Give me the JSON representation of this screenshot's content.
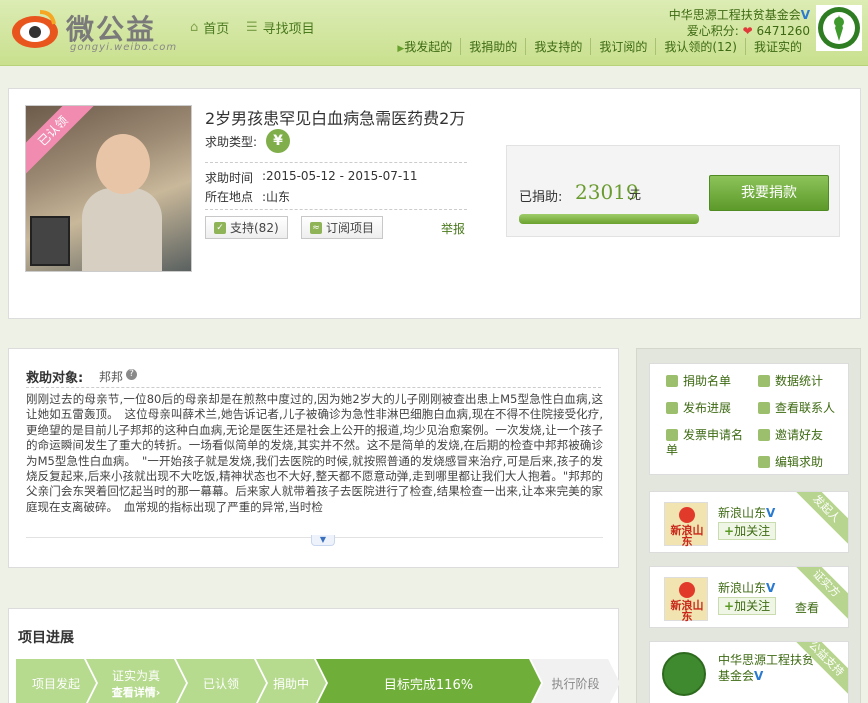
{
  "header": {
    "logo_title": "微公益",
    "logo_domain": "gongyi.weibo.com",
    "nav": [
      {
        "label": "首页",
        "icon": "home-icon"
      },
      {
        "label": "寻找项目",
        "icon": "list-icon"
      }
    ],
    "org_name": "中华思源工程扶贫基金会",
    "love_label": "爱心积分:",
    "love_value": "6471260",
    "subnav": [
      "我发起的",
      "我捐助的",
      "我支持的",
      "我订阅的",
      "我认领的(12)",
      "我证实的"
    ]
  },
  "project": {
    "ribbon": "已认领",
    "title": "2岁男孩患罕见白血病急需医药费2万",
    "help_type_label": "求助类型:",
    "help_type_icon": "¥",
    "time_label": "求助时间",
    "time_value": ":2015-05-12 - 2015-07-11",
    "place_label": "所在地点",
    "place_value": ":山东",
    "support_label": "支持(82)",
    "subscribe_label": "订阅项目",
    "report_label": "举报",
    "donated_label": "已捐助:",
    "donated_value": "23019",
    "donated_unit": "元",
    "donate_progress": 1.0,
    "donate_button": "我要捐款"
  },
  "story": {
    "heading": "救助对象:",
    "name": "邦邦",
    "help_icon": "?",
    "text": "刚刚过去的母亲节,一位80后的母亲却是在煎熬中度过的,因为她2岁大的儿子刚刚被查出患上M5型急性白血病,这让她如五雷轰顶。　这位母亲叫薛术兰,她告诉记者,儿子被确诊为急性非淋巴细胞白血病,现在不得不住院接受化疗,更绝望的是目前儿子邦邦的这种白血病,无论是医生还是社会上公开的报道,均少见治愈案例。一次发烧,让一个孩子的命运瞬间发生了重大的转折。一场看似简单的发烧,其实并不然。这不是简单的发烧,在后期的检查中邦邦被确诊为M5型急性白血病。　\"一开始孩子就是发烧,我们去医院的时候,就按照普通的发烧感冒来治疗,可是后来,孩子的发烧反复起来,后来小孩就出现不大吃饭,精神状态也不大好,整天都不愿意动弹,走到哪里都让我们大人抱着。\"邦邦的父亲门会东哭着回忆起当时的那一幕幕。后来家人就带着孩子去医院进行了检查,结果检查一出来,让本来完美的家庭现在支离破碎。　血常规的指标出现了严重的异常,当时检"
  },
  "progress": {
    "title": "项目进展",
    "steps": [
      {
        "label": "项目发起",
        "sub": ""
      },
      {
        "label": "证实为真",
        "sub": "查看详情›"
      },
      {
        "label": "已认领",
        "sub": ""
      },
      {
        "label": "捐助中",
        "sub": ""
      },
      {
        "label": "目标完成116%",
        "sub": ""
      },
      {
        "label": "执行阶段",
        "sub": ""
      }
    ]
  },
  "sidebar": {
    "actions": [
      {
        "label": "捐助名单",
        "icon": "donor-list-icon"
      },
      {
        "label": "数据统计",
        "icon": "stats-icon"
      },
      {
        "label": "发布进展",
        "icon": "publish-icon"
      },
      {
        "label": "查看联系人",
        "icon": "contact-icon"
      },
      {
        "label": "发票申请名单",
        "icon": "invoice-icon"
      },
      {
        "label": "邀请好友",
        "icon": "invite-icon"
      },
      {
        "label": "编辑求助",
        "icon": "edit-icon"
      }
    ],
    "initiator": {
      "name": "新浪山东",
      "logo_text": "新浪山东",
      "follow": "加关注",
      "corner": "发起人"
    },
    "verifier": {
      "name": "新浪山东",
      "logo_text": "新浪山东",
      "follow": "加关注",
      "view": "查看",
      "corner": "证实方"
    },
    "supporter": {
      "name": "中华思源工程扶贫基金会",
      "corner": "公益支持"
    }
  }
}
